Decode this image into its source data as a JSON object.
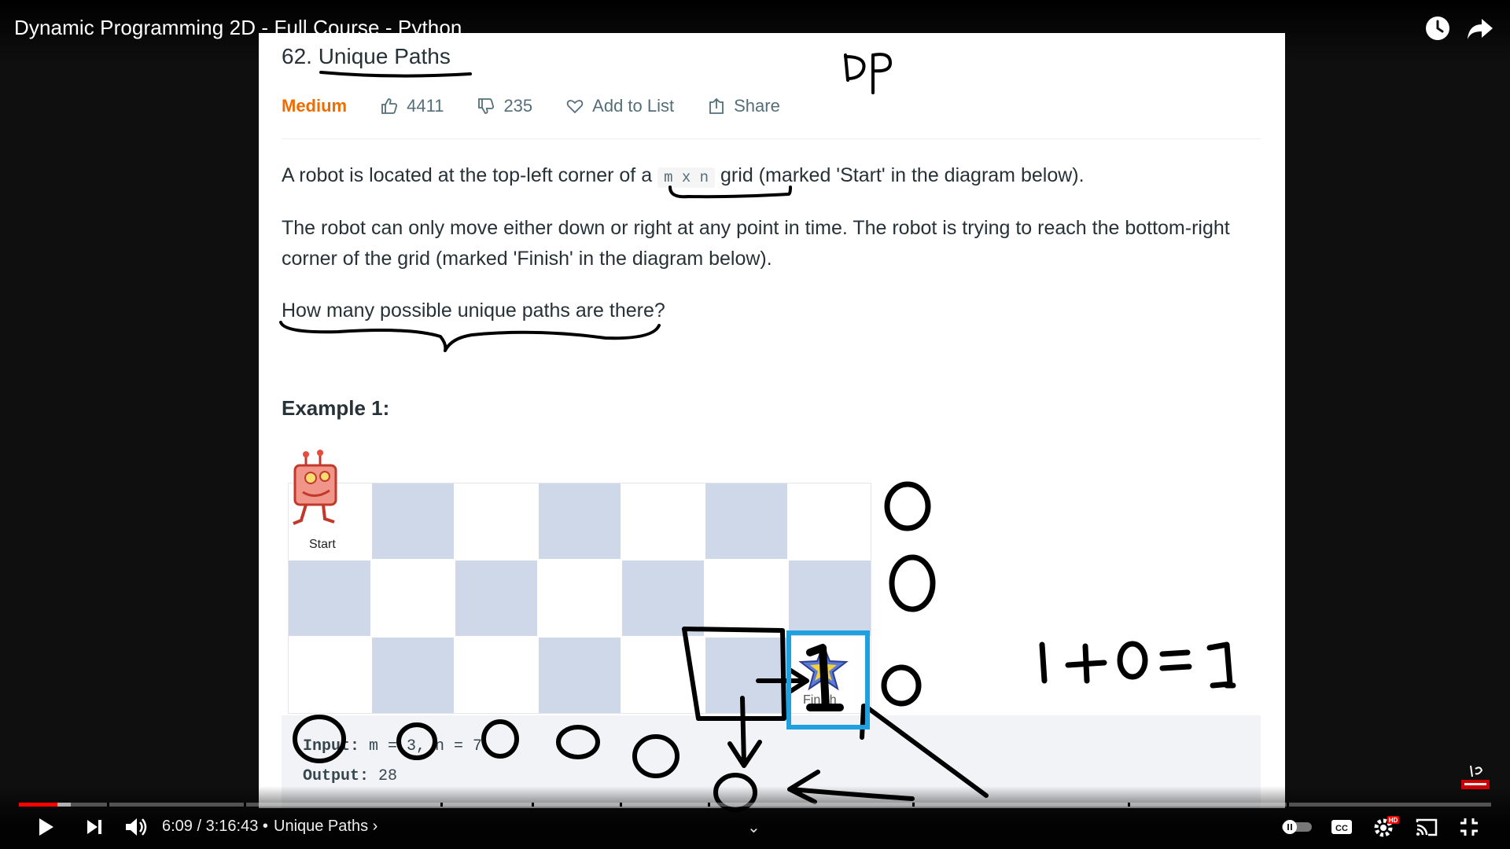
{
  "video": {
    "title": "Dynamic Programming 2D - Full Course - Python"
  },
  "problem": {
    "title": "62. Unique Paths",
    "difficulty": "Medium",
    "likes": "4411",
    "dislikes": "235",
    "add_to_list": "Add to List",
    "share": "Share",
    "para1_before": "A robot is located at the top-left corner of a",
    "para1_code": "m x n",
    "para1_after": "grid (marked 'Start' in the diagram below).",
    "para2": "The robot can only move either down or right at any point in time. The robot is trying to reach the bottom-right corner of the grid (marked 'Finish' in the diagram below).",
    "para3": "How many possible unique paths are there?",
    "example_title": "Example 1:",
    "start_label": "Start",
    "finish_label": "Finish",
    "input_label": "Input:",
    "input_value": "m = 3, n = 7",
    "output_label": "Output:",
    "output_value": "28"
  },
  "annotations": {
    "dp": "DP",
    "equation": "1 +0 = 1",
    "cell_one": "1",
    "zero": "0"
  },
  "player": {
    "current_time": "6:09",
    "duration": "3:16:43",
    "chapter": "Unique Paths",
    "progress_played": 0.026,
    "progress_buffered": 0.035
  },
  "colors": {
    "accent": "#ff0000",
    "difficulty": "#ef6c00",
    "grid_shade": "#cfd8e9",
    "finish_box": "#1fa0e0"
  }
}
